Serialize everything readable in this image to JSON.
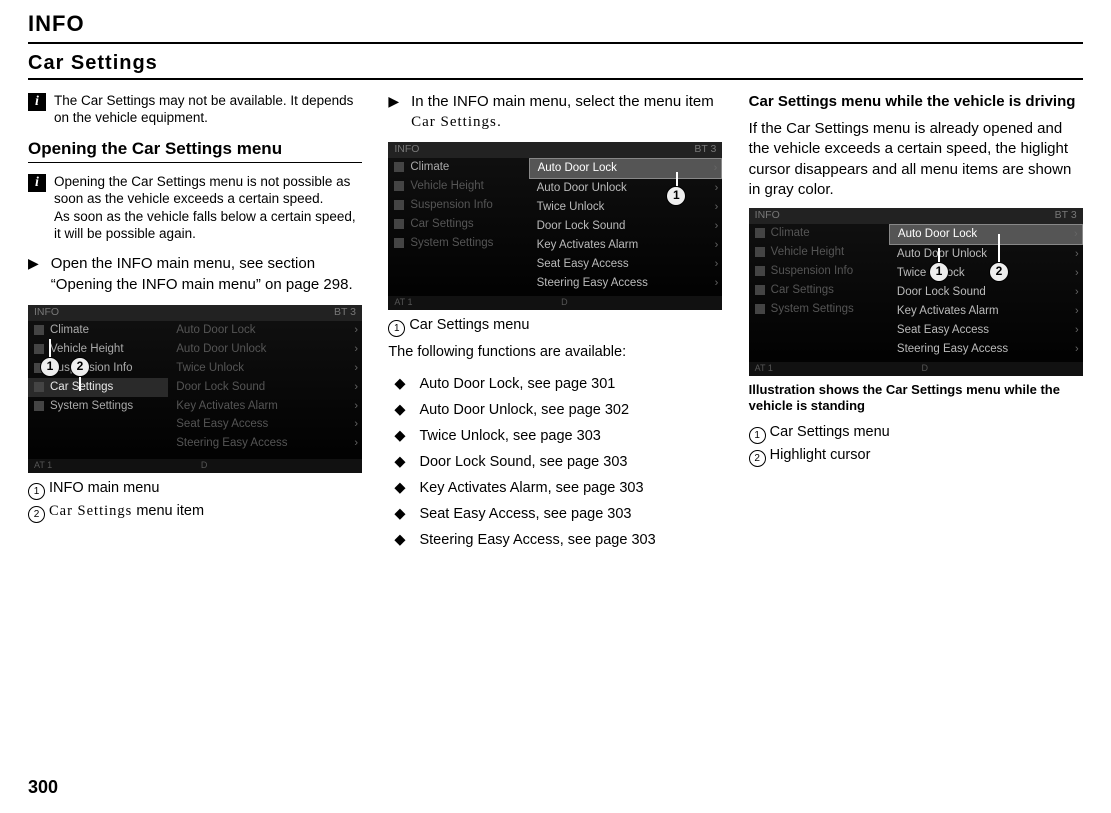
{
  "header": {
    "title": "INFO"
  },
  "section": {
    "title": "Car Settings"
  },
  "col1": {
    "info1": "The Car Settings may not be available. It depends on the vehicle equipment.",
    "h3": "Opening the Car Settings menu",
    "info2": "Opening the Car Settings menu is not possible as soon as the vehicle exceeds a certain speed.\nAs soon as the vehicle falls below a certain speed, it will be possible again.",
    "step1": "Open the INFO main menu, see section “Opening the INFO main menu” on page 298.",
    "legend1": "INFO main menu",
    "legend2_pre": "Car Settings",
    "legend2_post": " menu item"
  },
  "col2": {
    "step_pre": "In the INFO main menu, select the menu item ",
    "step_menu": "Car Settings",
    "step_post": ".",
    "legend1": "Car Settings menu",
    "caption": "The following functions are available:",
    "funcs": [
      "Auto Door Lock, see page 301",
      "Auto Door Unlock, see page 302",
      "Twice Unlock, see page 303",
      "Door Lock Sound, see page 303",
      "Key Activates Alarm, see page 303",
      "Seat Easy Access, see page 303",
      "Steering Easy Access, see page 303"
    ]
  },
  "col3": {
    "heading": "Car Settings menu while the vehicle is driving",
    "para": "If the Car Settings menu is already opened and the vehicle exceeds a certain speed, the higlight cursor disappears and all menu items are shown in gray color.",
    "figcap": "Illustration shows the Car Settings menu while the vehicle is standing",
    "legend1": "Car Settings menu",
    "legend2": "Highlight cursor"
  },
  "screen": {
    "top_left": "INFO",
    "top_right": "BT 3",
    "left_items": [
      "Climate",
      "Vehicle Height",
      "Suspension Info",
      "Car Settings",
      "System Settings"
    ],
    "right_items": [
      "Auto Door Lock",
      "Auto Door Unlock",
      "Twice Unlock",
      "Door Lock Sound",
      "Key Activates Alarm",
      "Seat Easy Access",
      "Steering Easy Access"
    ],
    "bottom_left": "AT 1",
    "bottom_mid": "D"
  },
  "page_number": "300"
}
